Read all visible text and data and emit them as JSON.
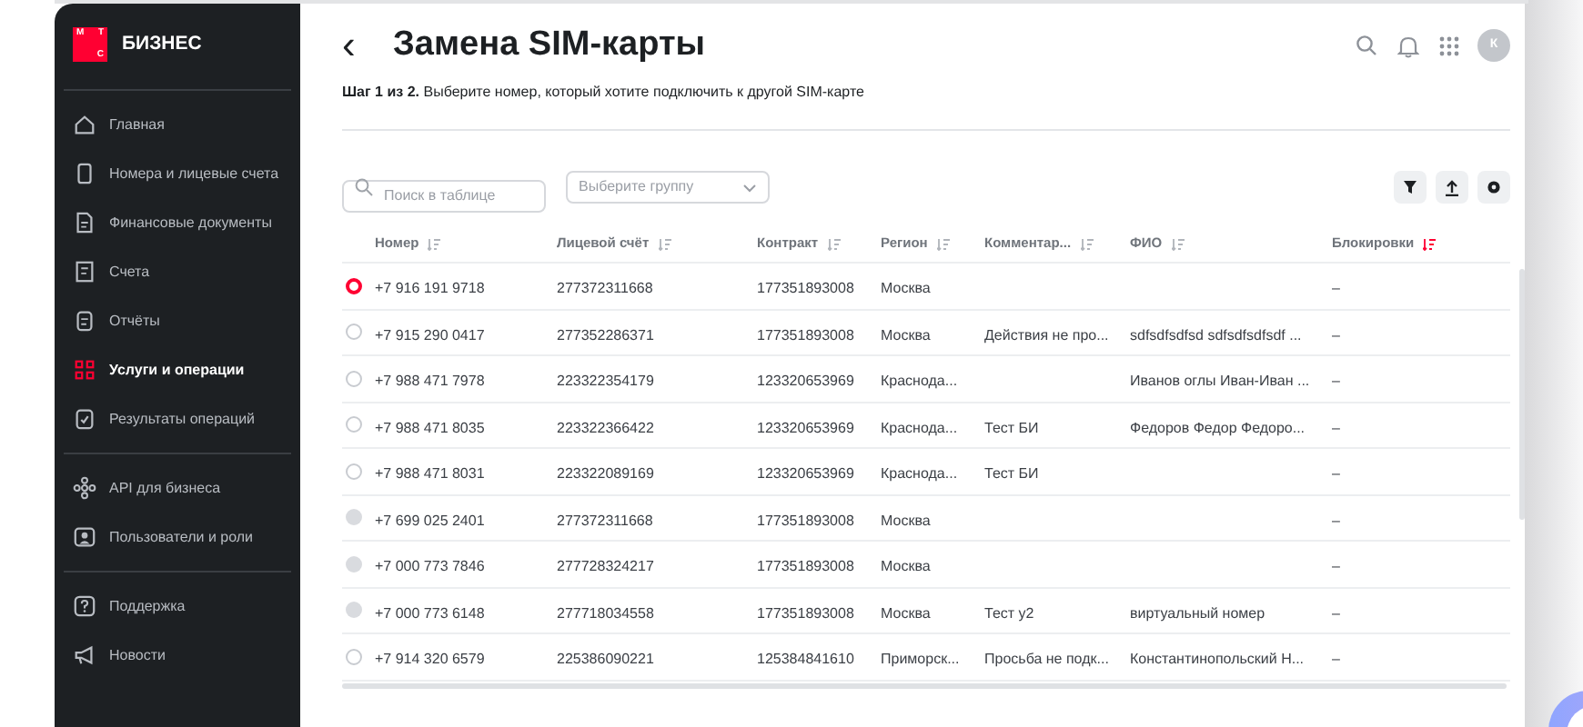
{
  "sidebar": {
    "logo": {
      "mark": [
        "М",
        "Т",
        "С"
      ],
      "text": "БИЗНЕС"
    },
    "groups": [
      [
        {
          "label": "Главная",
          "kind": "home",
          "selected": false
        },
        {
          "label": "Номера и лицевые счета",
          "kind": "phone",
          "selected": false
        },
        {
          "label": "Финансовые документы",
          "kind": "doc",
          "selected": false
        },
        {
          "label": "Счета",
          "kind": "bill",
          "selected": false
        },
        {
          "label": "Отчёты",
          "kind": "report",
          "selected": false
        },
        {
          "label": "Услуги и операции",
          "kind": "grid",
          "selected": true
        },
        {
          "label": "Результаты операций",
          "kind": "check",
          "selected": false
        }
      ],
      [
        {
          "label": "API для бизнеса",
          "kind": "api",
          "selected": false
        },
        {
          "label": "Пользователи и роли",
          "kind": "users",
          "selected": false
        }
      ],
      [
        {
          "label": "Поддержка",
          "kind": "help",
          "selected": false
        },
        {
          "label": "Новости",
          "kind": "news",
          "selected": false
        }
      ]
    ]
  },
  "header": {
    "back": "‹",
    "title": "Замена SIM-карты",
    "avatar": "К"
  },
  "step": "**Шаг 1 из 2.** Выберите номер, который хотите подключить к другой SIM-карте",
  "toolbar": {
    "search": {
      "placeholder": "Поиск в таблице"
    },
    "group": {
      "placeholder": "Выберите группу"
    }
  },
  "table": {
    "columns": [
      {
        "label": "Номер",
        "sort_active": false
      },
      {
        "label": "Лицевой счёт",
        "sort_active": false
      },
      {
        "label": "Контракт",
        "sort_active": false
      },
      {
        "label": "Регион",
        "sort_active": false
      },
      {
        "label": "Комментар...",
        "sort_active": false
      },
      {
        "label": "ФИО",
        "sort_active": false
      },
      {
        "label": "Блокировки",
        "sort_active": true
      }
    ],
    "rows": [
      {
        "selected": true,
        "disabled": false,
        "cells": [
          "+7 916 191 9718",
          "277372311668",
          "177351893008",
          "Москва",
          "",
          "",
          "–"
        ]
      },
      {
        "selected": false,
        "disabled": false,
        "cells": [
          "+7 915 290 0417",
          "277352286371",
          "177351893008",
          "Москва",
          "Действия не про...",
          "sdfsdfsdfsd sdfsdfsdfsdf ...",
          "–"
        ]
      },
      {
        "selected": false,
        "disabled": false,
        "cells": [
          "+7 988 471 7978",
          "223322354179",
          "123320653969",
          "Краснода...",
          "",
          "Иванов оглы Иван-Иван ...",
          "–"
        ]
      },
      {
        "selected": false,
        "disabled": false,
        "cells": [
          "+7 988 471 8035",
          "223322366422",
          "123320653969",
          "Краснода...",
          "Тест БИ",
          "Федоров Федор Федоро...",
          "–"
        ]
      },
      {
        "selected": false,
        "disabled": false,
        "cells": [
          "+7 988 471 8031",
          "223322089169",
          "123320653969",
          "Краснода...",
          "Тест БИ",
          "",
          "–"
        ]
      },
      {
        "selected": false,
        "disabled": true,
        "cells": [
          "+7 699 025 2401",
          "277372311668",
          "177351893008",
          "Москва",
          "",
          "",
          "–"
        ]
      },
      {
        "selected": false,
        "disabled": true,
        "cells": [
          "+7 000 773 7846",
          "277728324217",
          "177351893008",
          "Москва",
          "",
          "",
          "–"
        ]
      },
      {
        "selected": false,
        "disabled": true,
        "cells": [
          "+7 000 773 6148",
          "277718034558",
          "177351893008",
          "Москва",
          "Тест у2",
          "виртуальный номер",
          "–"
        ]
      },
      {
        "selected": false,
        "disabled": false,
        "cells": [
          "+7 914 320 6579",
          "225386090221",
          "125384841610",
          "Приморск...",
          "Просьба не подк...",
          "Константинопольский Н...",
          "–"
        ]
      }
    ]
  }
}
